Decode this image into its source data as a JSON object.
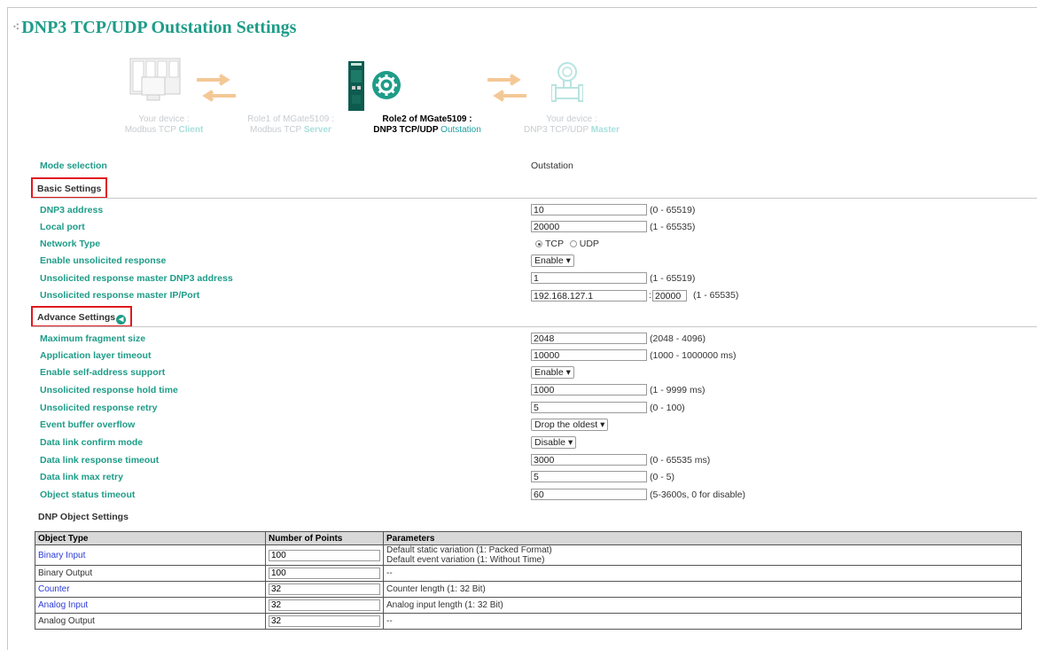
{
  "page_title": "DNP3 TCP/UDP Outstation Settings",
  "diagram": {
    "role1_device": {
      "line1": "Your device :",
      "line2a": "Modbus TCP ",
      "line2b": "Client"
    },
    "role1_gate": {
      "line1": "Role1 of MGate5109 :",
      "line2a": "Modbus TCP ",
      "line2b": "Server"
    },
    "role2_gate": {
      "line1": "Role2 of MGate5109 :",
      "line2a": "DNP3 TCP/UDP ",
      "line2b": "Outstation"
    },
    "role2_device": {
      "line1": "Your device :",
      "line2a": "DNP3 TCP/UDP ",
      "line2b": "Master"
    }
  },
  "mode": {
    "label": "Mode selection",
    "value": "Outstation"
  },
  "basic": {
    "title": "Basic Settings",
    "dnp3_address": {
      "label": "DNP3 address",
      "value": "10",
      "range": "(0 - 65519)"
    },
    "local_port": {
      "label": "Local port",
      "value": "20000",
      "range": "(1 - 65535)"
    },
    "network_type": {
      "label": "Network Type",
      "opt1": "TCP",
      "opt2": "UDP",
      "selected": "TCP"
    },
    "unsol_enable": {
      "label": "Enable unsolicited response",
      "value": "Enable"
    },
    "unsol_master_addr": {
      "label": "Unsolicited response master DNP3 address",
      "value": "1",
      "range": "(1 - 65519)"
    },
    "unsol_master_ip": {
      "label": "Unsolicited response master IP/Port",
      "ip": "192.168.127.1",
      "sep": ":",
      "port": "20000",
      "range": "(1 - 65535)"
    }
  },
  "advance": {
    "title": "Advance Settings",
    "max_fragment": {
      "label": "Maximum fragment size",
      "value": "2048",
      "range": "(2048 - 4096)"
    },
    "app_timeout": {
      "label": "Application layer timeout",
      "value": "10000",
      "range": "(1000 - 1000000 ms)"
    },
    "self_address": {
      "label": "Enable self-address support",
      "value": "Enable"
    },
    "unsol_hold": {
      "label": "Unsolicited response hold time",
      "value": "1000",
      "range": "(1 - 9999 ms)"
    },
    "unsol_retry": {
      "label": "Unsolicited response retry",
      "value": "5",
      "range": "(0 - 100)"
    },
    "event_overflow": {
      "label": "Event buffer overflow",
      "value": "Drop the oldest"
    },
    "dl_confirm": {
      "label": "Data link confirm mode",
      "value": "Disable"
    },
    "dl_timeout": {
      "label": "Data link response timeout",
      "value": "3000",
      "range": "(0 - 65535 ms)"
    },
    "dl_retry": {
      "label": "Data link max retry",
      "value": "5",
      "range": "(0 - 5)"
    },
    "obj_status": {
      "label": "Object status timeout",
      "value": "60",
      "range": "(5-3600s, 0 for disable)"
    }
  },
  "dnp_objects": {
    "title": "DNP Object Settings",
    "headers": [
      "Object Type",
      "Number of Points",
      "Parameters"
    ],
    "rows": [
      {
        "type": "Binary Input",
        "points": "100",
        "param1": "Default static variation (1: Packed Format)",
        "param2": "Default event variation (1: Without Time)"
      },
      {
        "type": "Binary Output",
        "points": "100",
        "param1": "--",
        "param2": ""
      },
      {
        "type": "Counter",
        "points": "32",
        "param1": "Counter length (1: 32 Bit)",
        "param2": ""
      },
      {
        "type": "Analog Input",
        "points": "32",
        "param1": "Analog input length (1: 32 Bit)",
        "param2": ""
      },
      {
        "type": "Analog Output",
        "points": "32",
        "param1": "--",
        "param2": ""
      }
    ]
  },
  "colors": {
    "accent": "#1e9c88",
    "highlight": "#e0191e",
    "link": "#2b3bd6",
    "arrow": "#f4c896"
  }
}
